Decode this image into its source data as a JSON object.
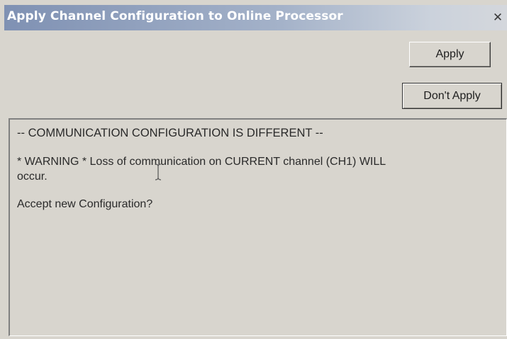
{
  "window": {
    "title": "Apply Channel Configuration to Online Processor",
    "close_glyph": "✕"
  },
  "buttons": {
    "apply_label": "Apply",
    "dont_apply_label": "Don't Apply"
  },
  "message": {
    "line1": "-- COMMUNICATION CONFIGURATION IS DIFFERENT --",
    "line2": "* WARNING * Loss of communication on CURRENT channel  (CH1) WILL",
    "line3": "occur.",
    "line4": "Accept new Configuration?"
  },
  "cursor_icon": "ibeam-cursor-icon"
}
